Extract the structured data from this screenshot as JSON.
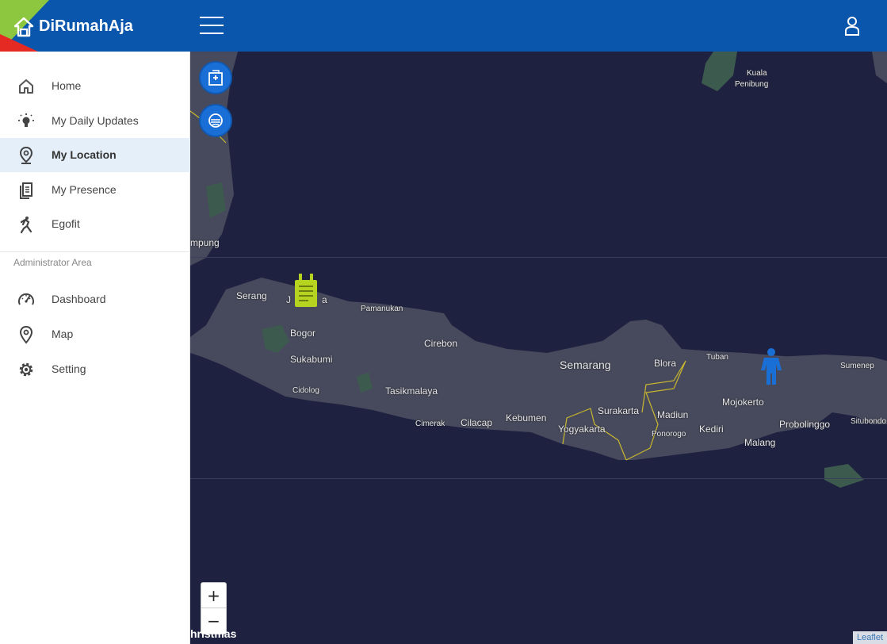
{
  "app": {
    "brand_name": "DiRumahAja"
  },
  "sidebar": {
    "items": [
      {
        "label": "Home",
        "icon": "home-icon"
      },
      {
        "label": "My Daily Updates",
        "icon": "bulb-icon"
      },
      {
        "label": "My Location",
        "icon": "location-pin-icon",
        "active": true
      },
      {
        "label": "My Presence",
        "icon": "documents-icon"
      },
      {
        "label": "Egofit",
        "icon": "running-icon"
      }
    ],
    "admin_title": "Administrator Area",
    "admin_items": [
      {
        "label": "Dashboard",
        "icon": "speedometer-icon"
      },
      {
        "label": "Map",
        "icon": "map-pin-icon"
      },
      {
        "label": "Setting",
        "icon": "gear-icon"
      }
    ]
  },
  "map": {
    "zoom_in": "+",
    "zoom_out": "−",
    "attribution": "Leaflet",
    "bottom_label": "hristmas",
    "places": {
      "kuala": "Kuala",
      "penibung": "Penibung",
      "mpung": "mpung",
      "serang": "Serang",
      "jakarta_j": "J",
      "jakarta_a": "a",
      "pamanukan": "Pamanukan",
      "bogor": "Bogor",
      "sukabumi": "Sukabumi",
      "cirebon": "Cirebon",
      "semarang": "Semarang",
      "blora": "Blora",
      "tuban": "Tuban",
      "sumenep": "Sumenep",
      "cidolog": "Cidolog",
      "tasikmalaya": "Tasikmalaya",
      "surakarta": "Surakarta",
      "madiun": "Madiun",
      "mojokerto": "Mojokerto",
      "cimerak": "Cimerak",
      "cilacap": "Cilacap",
      "kebumen": "Kebumen",
      "yogyakarta": "Yogyakarta",
      "ponorogo": "Ponorogo",
      "kediri": "Kediri",
      "probolinggo": "Probolinggo",
      "situbondo": "Situbondo",
      "malang": "Malang"
    }
  },
  "colors": {
    "header": "#0b56ad",
    "accent_green": "#8dc63f",
    "accent_red": "#e52a23",
    "map_water": "#1e2240",
    "map_land": "#474a5c",
    "marker_hospital": "#b5d31f",
    "marker_person": "#1a6fd6"
  }
}
